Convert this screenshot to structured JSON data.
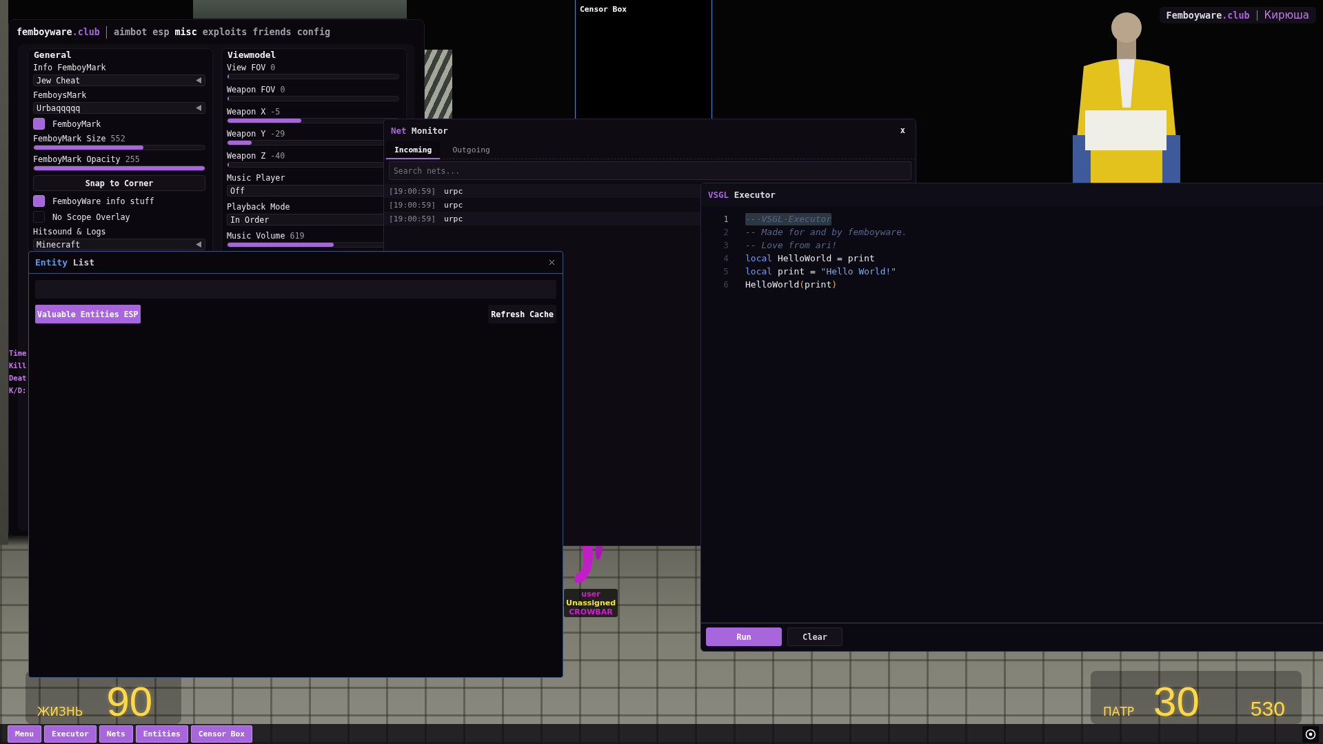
{
  "menu": {
    "brand": "femboyware",
    "brand_suffix": ".club",
    "tabs": [
      {
        "label": "aimbot",
        "selected": false
      },
      {
        "label": "esp",
        "selected": false
      },
      {
        "label": "misc",
        "selected": true
      },
      {
        "label": "exploits",
        "selected": false
      },
      {
        "label": "friends",
        "selected": false
      },
      {
        "label": "config",
        "selected": false
      }
    ],
    "groups": [
      {
        "title": "General",
        "items": [
          {
            "kind": "dropdown",
            "label": "Info FemboyMark",
            "value": "Jew Cheat"
          },
          {
            "kind": "dropdown",
            "label": "FemboysMark",
            "value": "Urbaqqqqq"
          },
          {
            "kind": "checkbox",
            "label": "FemboyMark",
            "checked": true
          },
          {
            "kind": "slider",
            "label": "FemboyMark Size",
            "reading": "552",
            "level": 0.64
          },
          {
            "kind": "slider",
            "label": "FemboyMark Opacity",
            "reading": "255",
            "level": 1
          },
          {
            "kind": "button",
            "label": "Snap to Corner"
          },
          {
            "kind": "checkbox",
            "label": "FemboyWare info stuff",
            "checked": true
          },
          {
            "kind": "checkbox",
            "label": "No Scope Overlay",
            "checked": false
          },
          {
            "kind": "dropdown",
            "label": "Hitsound & Logs",
            "value": "Minecraft"
          }
        ]
      },
      {
        "title": "Viewmodel",
        "items": [
          {
            "kind": "slider",
            "label": "View FOV",
            "reading": "0",
            "level": 0
          },
          {
            "kind": "slider",
            "label": "Weapon FOV",
            "reading": "0",
            "level": 0
          },
          {
            "kind": "slider",
            "label": "Weapon X",
            "reading": "-5",
            "level": 0.43
          },
          {
            "kind": "slider",
            "label": "Weapon Y",
            "reading": "-29",
            "level": 0.14
          },
          {
            "kind": "slider",
            "label": "Weapon Z",
            "reading": "-40",
            "level": 0
          },
          {
            "kind": "dropdown",
            "label": "Music Player",
            "value": "Off"
          },
          {
            "kind": "dropdown",
            "label": "Playback Mode",
            "value": "In Order"
          },
          {
            "kind": "slider",
            "label": "Music Volume",
            "reading": "619",
            "level": 0.62
          }
        ]
      }
    ]
  },
  "censor_box": {
    "title": "Censor Box"
  },
  "brand_tag": {
    "brand": "Femboyware",
    "brand_suffix": ".club",
    "user": "Кирюша"
  },
  "net_monitor": {
    "title_accent": "Net",
    "title": "Monitor",
    "close": "x",
    "tabs": [
      {
        "label": "Incoming",
        "selected": true
      },
      {
        "label": "Outgoing",
        "selected": false
      }
    ],
    "search": {
      "placeholder": "Search nets..."
    },
    "rows": [
      {
        "time": "[19:00:59]",
        "name": "urpc"
      },
      {
        "time": "[19:00:59]",
        "name": "urpc"
      },
      {
        "time": "[19:00:59]",
        "name": "urpc"
      }
    ]
  },
  "executor": {
    "title_accent": "VSGL",
    "title": "Executor",
    "lines": [
      {
        "number": "1",
        "selected": true,
        "tokens": [
          {
            "kind": "comment",
            "text": "--·VSGL·Executor"
          }
        ]
      },
      {
        "number": "2",
        "selected": false,
        "tokens": [
          {
            "kind": "comment",
            "text": "-- Made for and by femboyware."
          }
        ]
      },
      {
        "number": "3",
        "selected": false,
        "tokens": [
          {
            "kind": "comment",
            "text": "-- Love from ari!"
          }
        ]
      },
      {
        "number": "4",
        "selected": false,
        "tokens": [
          {
            "kind": "keyword",
            "text": "local"
          },
          {
            "kind": "name",
            "text": " HelloWorld = print"
          }
        ]
      },
      {
        "number": "5",
        "selected": false,
        "tokens": [
          {
            "kind": "keyword",
            "text": "local"
          },
          {
            "kind": "name",
            "text": " print = "
          },
          {
            "kind": "string",
            "text": "\"Hello World!\""
          }
        ]
      },
      {
        "number": "6",
        "selected": false,
        "tokens": [
          {
            "kind": "name",
            "text": "HelloWorld"
          },
          {
            "kind": "paren",
            "text": "("
          },
          {
            "kind": "name",
            "text": "print"
          },
          {
            "kind": "paren",
            "text": ")"
          }
        ]
      }
    ],
    "buttons": [
      {
        "kind": "primary",
        "label": "Run"
      },
      {
        "kind": "secondary",
        "label": "Clear"
      }
    ]
  },
  "entity_list": {
    "title_accent": "Entity",
    "title": "List",
    "buttons": [
      {
        "kind": "primary",
        "label": "Valuable Entities ESP"
      },
      {
        "kind": "secondary",
        "label": "Refresh Cache"
      }
    ]
  },
  "info_overlay": {
    "lines": [
      "Time",
      "Kill",
      "Deat",
      "K/D:"
    ]
  },
  "esp_tag": {
    "lines": [
      {
        "text": "user",
        "color": "#d21ed2"
      },
      {
        "text": "Unassigned",
        "color": "#f2e23c"
      },
      {
        "text": "CROWBAR",
        "color": "#d21ed2"
      }
    ]
  },
  "hud": {
    "health": {
      "label": "ЖИЗНЬ",
      "value": "90"
    },
    "ammo": {
      "label": "ПАТР",
      "clip": "30",
      "reserve": "530"
    }
  },
  "taskbar": {
    "buttons": [
      "Menu",
      "Executor",
      "Nets",
      "Entities",
      "Censor Box"
    ]
  }
}
